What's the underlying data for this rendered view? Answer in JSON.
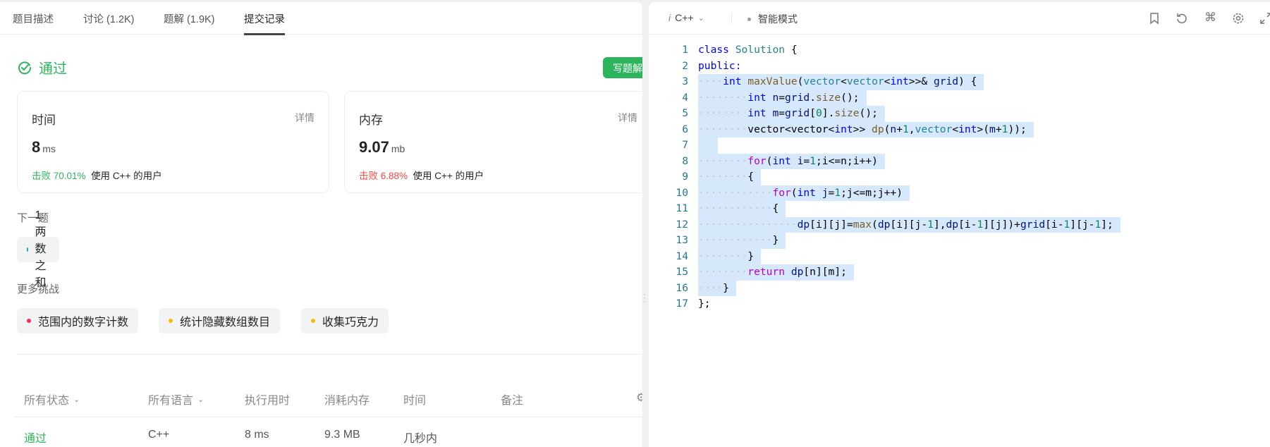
{
  "tabs": [
    {
      "label": "题目描述"
    },
    {
      "label": "讨论 (1.2K)"
    },
    {
      "label": "题解 (1.9K)"
    },
    {
      "label": "提交记录",
      "active": true
    }
  ],
  "status": {
    "text": "通过",
    "color": "#2db55d"
  },
  "write_solution_button": "写题解",
  "cards": [
    {
      "label": "时间",
      "detail": "详情",
      "value": "8",
      "unit": "ms",
      "beat_label": "击败 70.01%",
      "beat_color": "#2db55d",
      "rest": "使用 C++ 的用户"
    },
    {
      "label": "内存",
      "detail": "详情",
      "value": "9.07",
      "unit": "mb",
      "beat_label": "击败 6.88%",
      "beat_color": "#ef4743",
      "rest": "使用 C++ 的用户"
    }
  ],
  "next_problem": {
    "heading": "下一题",
    "items": [
      {
        "label": "1. 两数之和",
        "dot": "#00af9b"
      }
    ]
  },
  "more_challenges": {
    "heading": "更多挑战",
    "items": [
      {
        "label": "范围内的数字计数",
        "dot": "#ff2d55"
      },
      {
        "label": "统计隐藏数组数目",
        "dot": "#ffb800"
      },
      {
        "label": "收集巧克力",
        "dot": "#ffb800"
      }
    ]
  },
  "table": {
    "headers": [
      "所有状态",
      "所有语言",
      "执行用时",
      "消耗内存",
      "时间",
      "备注"
    ],
    "rows": [
      {
        "status": "通过",
        "language": "C++",
        "runtime": "8 ms",
        "memory": "9.3 MB",
        "time": "几秒内",
        "note": ""
      }
    ]
  },
  "editor": {
    "language": "C++",
    "mode": "智能模式",
    "icons": [
      "bookmark-icon",
      "reset-icon",
      "shortcut-icon",
      "settings-icon",
      "expand-icon"
    ],
    "lines": [
      [
        [
          "class",
          "kw"
        ],
        [
          " ",
          "pl"
        ],
        [
          "Solution",
          "ty"
        ],
        [
          " {",
          "pl"
        ]
      ],
      [
        [
          "public:",
          "kw"
        ]
      ],
      [
        [
          "    ",
          "ws"
        ],
        [
          "int",
          "kw"
        ],
        [
          " ",
          "pl"
        ],
        [
          "maxValue",
          "fn"
        ],
        [
          "(",
          "pl"
        ],
        [
          "vector",
          "ty"
        ],
        [
          "<",
          "pl"
        ],
        [
          "vector",
          "ty"
        ],
        [
          "<",
          "pl"
        ],
        [
          "int",
          "kw"
        ],
        [
          ">>& ",
          "pl"
        ],
        [
          "grid",
          "var"
        ],
        [
          ") {",
          "pl"
        ]
      ],
      [
        [
          "        ",
          "ws"
        ],
        [
          "int",
          "kw"
        ],
        [
          " ",
          "pl"
        ],
        [
          "n",
          "var"
        ],
        [
          "=",
          "pl"
        ],
        [
          "grid",
          "var"
        ],
        [
          ".",
          "pl"
        ],
        [
          "size",
          "fn"
        ],
        [
          "();",
          "pl"
        ]
      ],
      [
        [
          "        ",
          "ws"
        ],
        [
          "int",
          "kw"
        ],
        [
          " ",
          "pl"
        ],
        [
          "m",
          "var"
        ],
        [
          "=",
          "pl"
        ],
        [
          "grid",
          "var"
        ],
        [
          "[",
          "pl"
        ],
        [
          "0",
          "num"
        ],
        [
          "].",
          "pl"
        ],
        [
          "size",
          "fn"
        ],
        [
          "();",
          "pl"
        ]
      ],
      [
        [
          "        ",
          "ws"
        ],
        [
          "vector<vector<",
          "pl"
        ],
        [
          "int",
          "kw"
        ],
        [
          ">> ",
          "pl"
        ],
        [
          "dp",
          "fn"
        ],
        [
          "(",
          "pl"
        ],
        [
          "n",
          "var"
        ],
        [
          "+",
          "pl"
        ],
        [
          "1",
          "num"
        ],
        [
          ",",
          "pl"
        ],
        [
          "vector",
          "ty"
        ],
        [
          "<",
          "pl"
        ],
        [
          "int",
          "kw"
        ],
        [
          ">(",
          "pl"
        ],
        [
          "m",
          "var"
        ],
        [
          "+",
          "pl"
        ],
        [
          "1",
          "num"
        ],
        [
          "));",
          "pl"
        ]
      ],
      [
        [
          "  ",
          "pl"
        ]
      ],
      [
        [
          "        ",
          "ws"
        ],
        [
          "for",
          "ctl"
        ],
        [
          "(",
          "pl"
        ],
        [
          "int",
          "kw"
        ],
        [
          " ",
          "pl"
        ],
        [
          "i",
          "var"
        ],
        [
          "=",
          "pl"
        ],
        [
          "1",
          "num"
        ],
        [
          ";i<=n;i++)",
          "pl"
        ]
      ],
      [
        [
          "        ",
          "ws"
        ],
        [
          "{",
          "pl"
        ]
      ],
      [
        [
          "            ",
          "ws"
        ],
        [
          "for",
          "ctl"
        ],
        [
          "(",
          "pl"
        ],
        [
          "int",
          "kw"
        ],
        [
          " ",
          "pl"
        ],
        [
          "j",
          "var"
        ],
        [
          "=",
          "pl"
        ],
        [
          "1",
          "num"
        ],
        [
          ";j<=m;j++)",
          "pl"
        ]
      ],
      [
        [
          "            ",
          "ws"
        ],
        [
          "{",
          "pl"
        ]
      ],
      [
        [
          "                ",
          "ws"
        ],
        [
          "dp",
          "var"
        ],
        [
          "[i][j]=",
          "pl"
        ],
        [
          "max",
          "fn"
        ],
        [
          "(",
          "pl"
        ],
        [
          "dp",
          "var"
        ],
        [
          "[i][j-",
          "pl"
        ],
        [
          "1",
          "num"
        ],
        [
          "],",
          "pl"
        ],
        [
          "dp",
          "var"
        ],
        [
          "[i-",
          "pl"
        ],
        [
          "1",
          "num"
        ],
        [
          "][j])+",
          "pl"
        ],
        [
          "grid",
          "var"
        ],
        [
          "[i-",
          "pl"
        ],
        [
          "1",
          "num"
        ],
        [
          "][j-",
          "pl"
        ],
        [
          "1",
          "num"
        ],
        [
          "];",
          "pl"
        ]
      ],
      [
        [
          "            ",
          "ws"
        ],
        [
          "}",
          "pl"
        ]
      ],
      [
        [
          "        ",
          "ws"
        ],
        [
          "}",
          "pl"
        ]
      ],
      [
        [
          "        ",
          "ws"
        ],
        [
          "return",
          "ctl"
        ],
        [
          " ",
          "pl"
        ],
        [
          "dp",
          "var"
        ],
        [
          "[n][m];",
          "pl"
        ]
      ],
      [
        [
          "    ",
          "ws"
        ],
        [
          "}",
          "pl"
        ]
      ],
      [
        [
          "};",
          "pl"
        ]
      ]
    ],
    "selected_lines": [
      3,
      4,
      5,
      6,
      7,
      8,
      9,
      10,
      11,
      12,
      13,
      14,
      15,
      16
    ]
  }
}
